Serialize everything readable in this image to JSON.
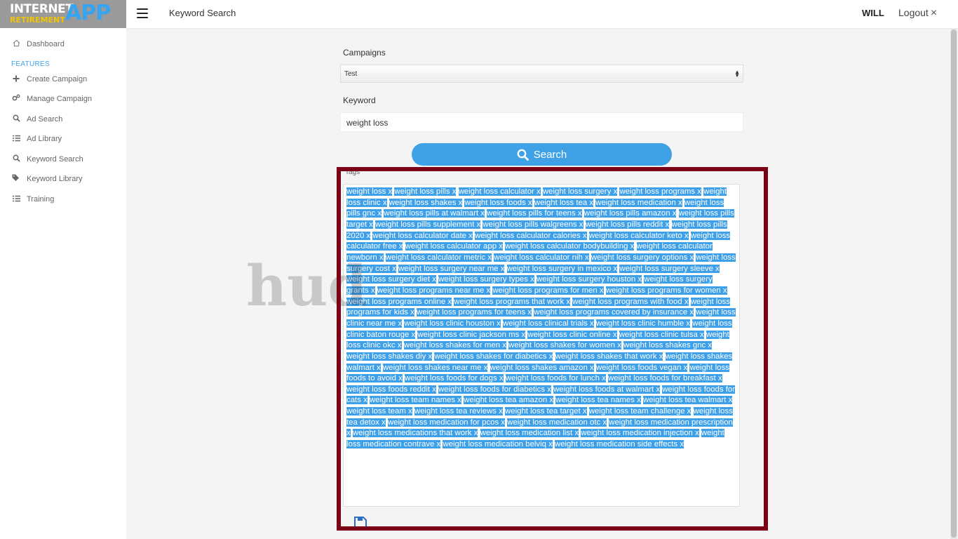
{
  "logo": {
    "line1": "INTERNET",
    "line2": "RETIREMENT",
    "line3": "APP"
  },
  "header": {
    "title": "Keyword Search",
    "user": "WILL",
    "logout": "Logout",
    "logout_icon": "×"
  },
  "sidebar": {
    "dashboard": "Dashboard",
    "section": "FEATURES",
    "items": [
      {
        "label": "Create Campaign",
        "icon": "plus-icon"
      },
      {
        "label": "Manage Campaign",
        "icon": "gears-icon"
      },
      {
        "label": "Ad Search",
        "icon": "search-icon"
      },
      {
        "label": "Ad Library",
        "icon": "list-icon"
      },
      {
        "label": "Keyword Search",
        "icon": "search-icon"
      },
      {
        "label": "Keyword Library",
        "icon": "tags-icon"
      },
      {
        "label": "Training",
        "icon": "list-icon"
      }
    ]
  },
  "form": {
    "campaigns_label": "Campaigns",
    "campaign_selected": "Test",
    "keyword_label": "Keyword",
    "keyword_value": "weight loss",
    "search_label": "Search",
    "tags_label": "Tags",
    "delete_glyph": "x"
  },
  "watermark": "hud",
  "tags": [
    "weight loss",
    "weight loss pills",
    "weight loss calculator",
    "weight loss surgery",
    "weight loss programs",
    "weight loss clinic",
    "weight loss shakes",
    "weight loss foods",
    "weight loss tea",
    "weight loss medication",
    "weight loss pills gnc",
    "weight loss pills at walmart",
    "weight loss pills for teens",
    "weight loss pills amazon",
    "weight loss pills target",
    "weight loss pills supplement",
    "weight loss pills walgreens",
    "weight loss pills reddit",
    "weight loss pills 2020",
    "weight loss calculator date",
    "weight loss calculator calories",
    "weight loss calculator keto",
    "weight loss calculator free",
    "weight loss calculator app",
    "weight loss calculator bodybuilding",
    "weight loss calculator newborn",
    "weight loss calculator metric",
    "weight loss calculator nih",
    "weight loss surgery options",
    "weight loss surgery cost",
    "weight loss surgery near me",
    "weight loss surgery in mexico",
    "weight loss surgery sleeve",
    "weight loss surgery diet",
    "weight loss surgery types",
    "weight loss surgery houston",
    "weight loss surgery grants",
    "weight loss programs near me",
    "weight loss programs for men",
    "weight loss programs for women",
    "weight loss programs online",
    "weight loss programs that work",
    "weight loss programs with food",
    "weight loss programs for kids",
    "weight loss programs for teens",
    "weight loss programs covered by insurance",
    "weight loss clinic near me",
    "weight loss clinic houston",
    "weight loss clinical trials",
    "weight loss clinic humble",
    "weight loss clinic baton rouge",
    "weight loss clinic jackson ms",
    "weight loss clinic online",
    "weight loss clinic tulsa",
    "weight loss clinic okc",
    "weight loss shakes for men",
    "weight loss shakes for women",
    "weight loss shakes gnc",
    "weight loss shakes diy",
    "weight loss shakes for diabetics",
    "weight loss shakes that work",
    "weight loss shakes walmart",
    "weight loss shakes near me",
    "weight loss shakes amazon",
    "weight loss foods vegan",
    "weight loss foods to avoid",
    "weight loss foods for dogs",
    "weight loss foods for lunch",
    "weight loss foods for breakfast",
    "weight loss foods reddit",
    "weight loss foods for diabetics",
    "weight loss foods at walmart",
    "weight loss foods for cats",
    "weight loss team names",
    "weight loss tea amazon",
    "weight loss tea names",
    "weight loss tea walmart",
    "weight loss team",
    "weight loss tea reviews",
    "weight loss tea target",
    "weight loss team challenge",
    "weight loss tea detox",
    "weight loss medication for pcos",
    "weight loss medication otc",
    "weight loss medication prescription",
    "weight loss medications that work",
    "weight loss medication list",
    "weight loss medication injection",
    "weight loss medication contrave",
    "weight loss medication belviq",
    "weight loss medication side effects"
  ],
  "colors": {
    "accent": "#3fa2e6",
    "frame": "#7b0016"
  }
}
